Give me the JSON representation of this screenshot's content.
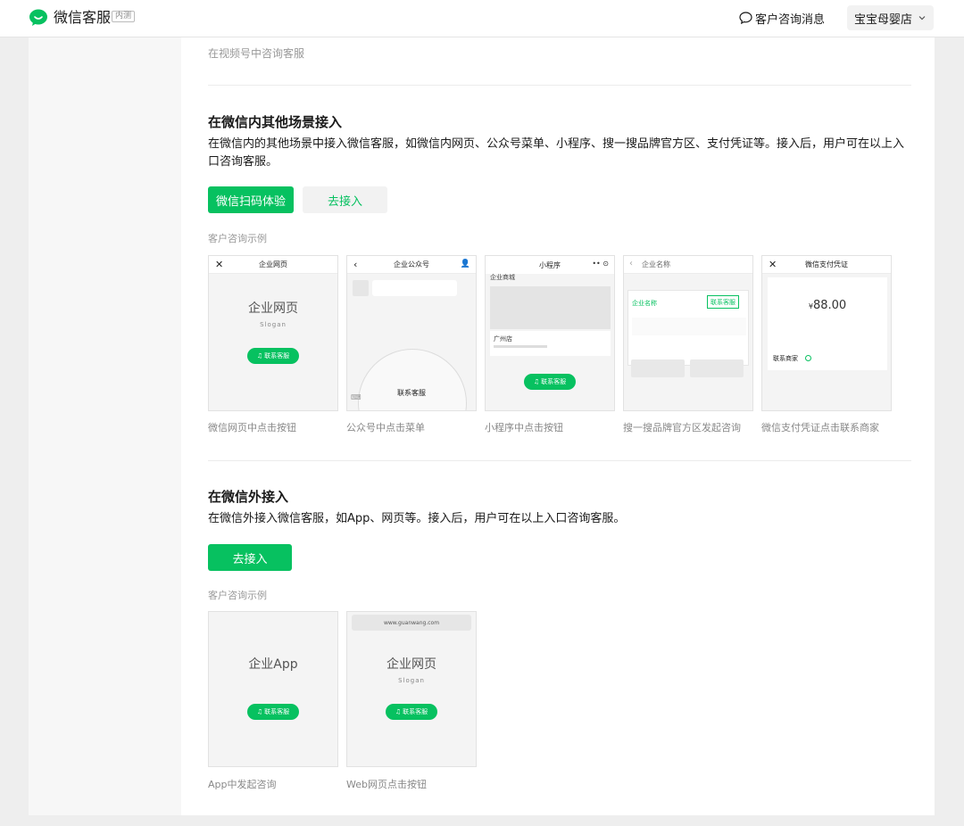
{
  "header": {
    "brand": "微信客服",
    "beta_badge": "内测",
    "customer_messages": "客户咨询消息",
    "shop_name": "宝宝母婴店"
  },
  "top": {
    "channels_hint": "在视频号中咨询客服"
  },
  "in_wechat": {
    "title": "在微信内其他场景接入",
    "description": "在微信内的其他场景中接入微信客服，如微信内网页、公众号菜单、小程序、搜一搜品牌官方区、支付凭证等。接入后，用户可在以上入口咨询客服。",
    "scan_button": "微信扫码体验",
    "access_button": "去接入",
    "examples_label": "客户咨询示例",
    "examples": [
      {
        "bar_title": "企业网页",
        "big_text": "企业网页",
        "slogan": "Slogan",
        "contact": "联系客服",
        "caption": "微信网页中点击按钮"
      },
      {
        "bar_title": "企业公众号",
        "contact": "联系客服",
        "caption": "公众号中点击菜单"
      },
      {
        "bar_title": "小程序",
        "mall": "企业商城",
        "store": "广州店",
        "contact": "联系客服",
        "caption": "小程序中点击按钮"
      },
      {
        "bar_title": "企业名称",
        "company": "企业名称",
        "contact": "联系客服",
        "caption": "搜一搜品牌官方区发起咨询"
      },
      {
        "bar_title": "微信支付凭证",
        "amount": "88.00",
        "currency": "¥",
        "contact_merchant": "联系商家",
        "caption": "微信支付凭证点击联系商家"
      }
    ]
  },
  "outside_wechat": {
    "title": "在微信外接入",
    "description": "在微信外接入微信客服，如App、网页等。接入后，用户可在以上入口咨询客服。",
    "access_button": "去接入",
    "examples_label": "客户咨询示例",
    "examples": [
      {
        "big_text": "企业App",
        "contact": "联系客服",
        "caption": "App中发起咨询"
      },
      {
        "url": "www.guanwang.com",
        "big_text": "企业网页",
        "slogan": "Slogan",
        "contact": "联系客服",
        "caption": "Web网页点击按钮"
      }
    ]
  }
}
